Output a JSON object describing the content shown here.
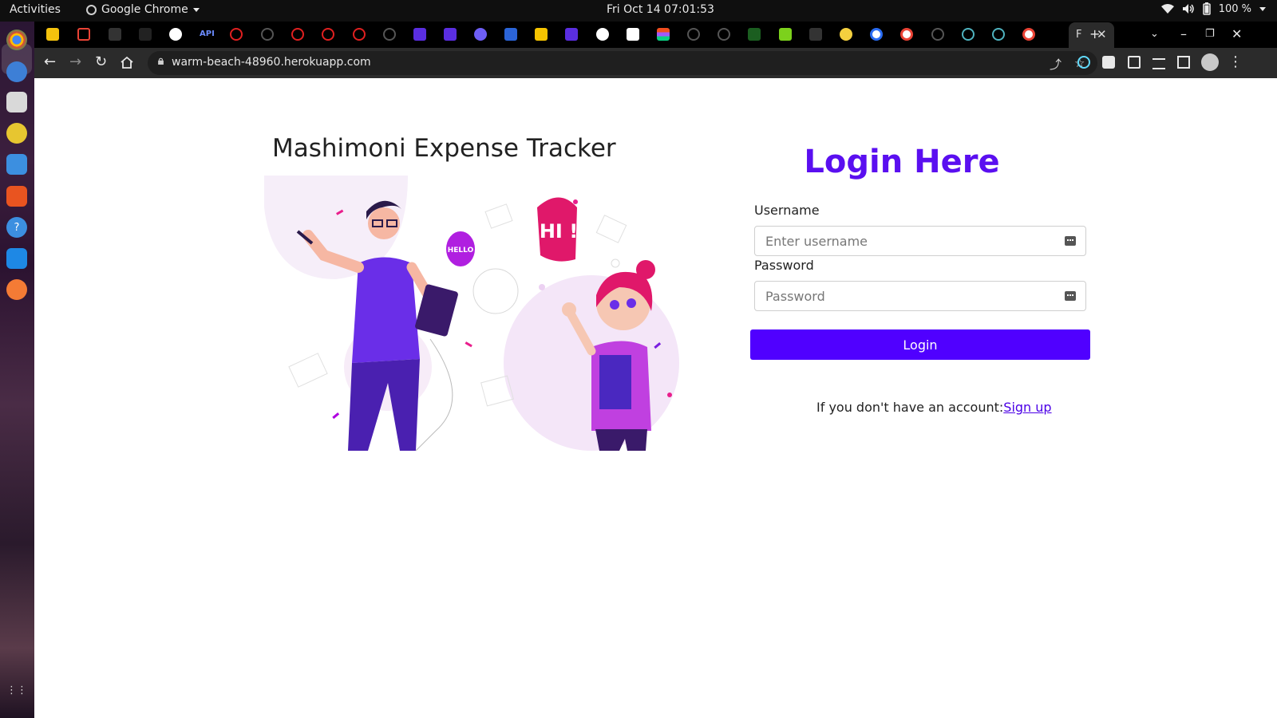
{
  "system": {
    "activities": "Activities",
    "app_name": "Google Chrome",
    "clock": "Fri Oct 14  07:01:53",
    "battery": "100 %"
  },
  "browser": {
    "active_tab_label": "F",
    "url": "warm-beach-48960.herokuapp.com",
    "tab_api_label": "API"
  },
  "page": {
    "app_title": "Mashimoni Expense Tracker",
    "login_heading": "Login Here",
    "username_label": "Username",
    "username_placeholder": "Enter username",
    "password_label": "Password",
    "password_placeholder": "Password",
    "login_button": "Login",
    "signup_prompt": "If you don't have an account:",
    "signup_link": "Sign up",
    "illustration_texts": {
      "hello": "HELLO",
      "hi": "HI !"
    }
  },
  "colors": {
    "accent": "#5000ff",
    "heading": "#5a0ff0",
    "link": "#4b00e6"
  }
}
